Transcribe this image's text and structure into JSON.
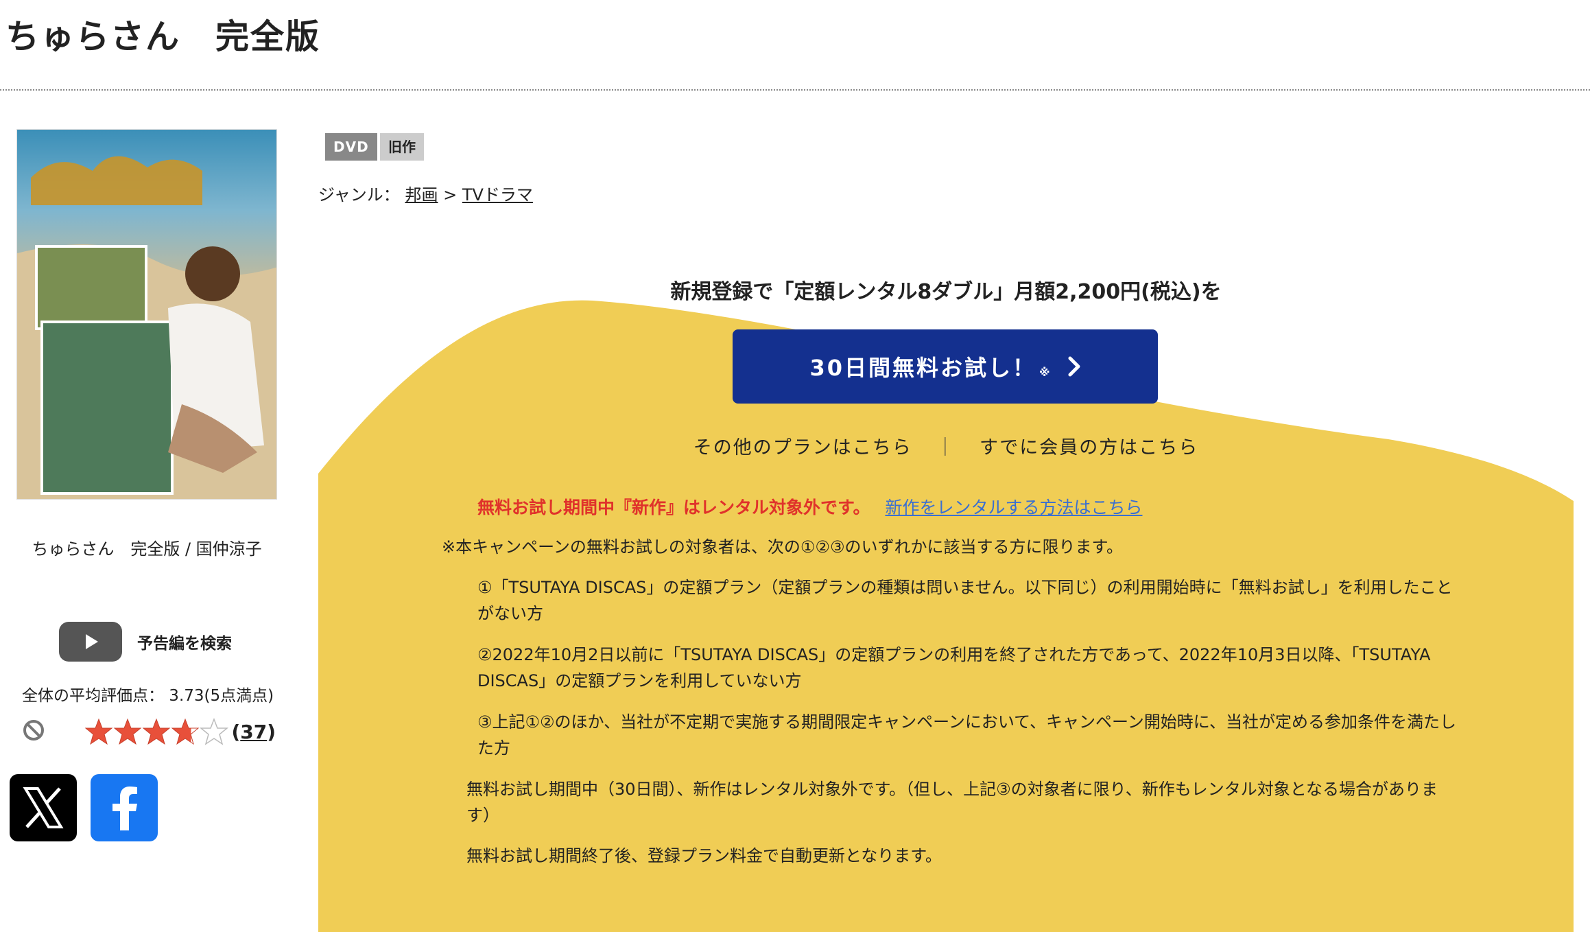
{
  "page": {
    "title": "ちゅらさん　完全版"
  },
  "product": {
    "caption": "ちゅらさん　完全版 / 国仲涼子",
    "cover_alt": "ちゅらさん 完全版 DVD",
    "trailer_label": "予告編を検索",
    "avg_rating_text": "全体の平均評価点： 3.73(5点満点)",
    "rating_value": 3.73,
    "rating_max": 5,
    "review_count": "37"
  },
  "tags": {
    "format": "DVD",
    "status": "旧作"
  },
  "genre": {
    "label": "ジャンル：",
    "level1": "邦画",
    "separator": ">",
    "level2": "TVドラマ"
  },
  "promo": {
    "heading": "新規登録で「定額レンタル8ダブル」月額2,200円(税込)を",
    "cta_label": "30日間無料お試し！",
    "cta_note": "※",
    "other_plans": "その他のプランはこちら",
    "divider": "｜",
    "member_link": "すでに会員の方はこちら",
    "warning": "無料お試し期間中『新作』はレンタル対象外です。",
    "warning_link": "新作をレンタルする方法はこちら",
    "intro": "※本キャンペーンの無料お試しの対象者は、次の①②③のいずれかに該当する方に限ります。",
    "condition_1": "①「TSUTAYA DISCAS」の定額プラン（定額プランの種類は問いません。以下同じ）の利用開始時に「無料お試し」を利用したことがない方",
    "condition_2": "②2022年10月2日以前に「TSUTAYA DISCAS」の定額プランの利用を終了された方であって、2022年10月3日以降、「TSUTAYA DISCAS」の定額プランを利用していない方",
    "condition_3": "③上記①②のほか、当社が不定期で実施する期間限定キャンペーンにおいて、キャンペーン開始時に、当社が定める参加条件を満たした方",
    "note_1": "無料お試し期間中（30日間）、新作はレンタル対象外です。（但し、上記③の対象者に限り、新作もレンタル対象となる場合があります）",
    "note_2": "無料お試し期間終了後、登録プラン料金で自動更新となります。"
  },
  "colors": {
    "cta": "#14308f",
    "yellow": "#f0cd55",
    "warning": "#e0322b",
    "link": "#3a6fd1",
    "star": "#e8503a"
  },
  "icons": {
    "trailer": "play-icon",
    "no_rating": "prohibited-icon",
    "social_x": "x-logo-icon",
    "social_facebook": "facebook-logo-icon",
    "cta_chevron": "chevron-right-icon"
  }
}
